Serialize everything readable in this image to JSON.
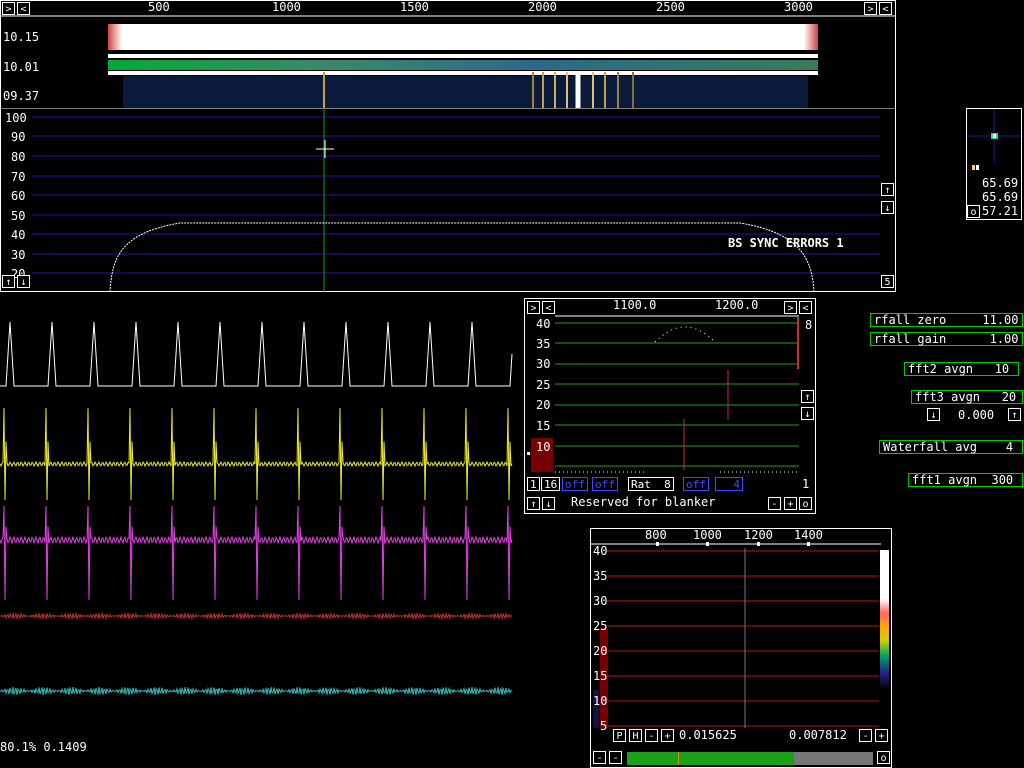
{
  "top": {
    "freq_ticks": [
      "500",
      "1000",
      "1500",
      "2000",
      "2500",
      "3000"
    ],
    "time_labels": [
      "10.15",
      "10.01",
      "09.37"
    ],
    "y_ticks": [
      "100",
      "90",
      "80",
      "70",
      "60",
      "50",
      "40",
      "30",
      "20"
    ],
    "overlay_text": "BS SYNC ERRORS 1",
    "corner_value": "5"
  },
  "side_panel": {
    "values": [
      "65.69",
      "65.69",
      "57.21"
    ],
    "o_label": "o"
  },
  "params": {
    "waterfall_zero": "rfall zero     11.00",
    "waterfall_gain": "rfall gain      1.00",
    "fft2_avgn": "fft2 avgn   10",
    "fft3_avgn": "fft3 avgn   20",
    "arrow_value": "0.000",
    "waterfall_avg": "Waterfall avg    4",
    "fft1_avgn": "fft1 avgn  300"
  },
  "mid_panel": {
    "freq_ticks": [
      "1100.0",
      "1200.0"
    ],
    "y_ticks": [
      "40",
      "35",
      "30",
      "25",
      "20",
      "15",
      "10"
    ],
    "right_value_top": "8",
    "right_value_bottom": "1",
    "ctl_1": "1",
    "ctl_16": "16",
    "ctl_off1": "off",
    "ctl_off2": "off",
    "ctl_rat": "Rat  8",
    "ctl_off3": "off",
    "ctl_4": "4",
    "reserved": "Reserved for blanker",
    "minus": "-",
    "plus": "+",
    "o": "o"
  },
  "bottom_panel": {
    "freq_ticks": [
      "800",
      "1000",
      "1200",
      "1400"
    ],
    "y_ticks": [
      "40",
      "35",
      "30",
      "25",
      "20",
      "15",
      "10",
      "5"
    ],
    "p_label": "P",
    "h_label": "H",
    "value_left": "0.015625",
    "value_right": "0.007812",
    "o": "o"
  },
  "status": {
    "text": "80.1% 0.1409"
  },
  "colors": {
    "grid_blue": "#1a1aa6",
    "grid_green": "#1ea01e",
    "grid_red": "#b01818",
    "trace_white": "#ffffff",
    "trace_yellow": "#e8e830",
    "trace_magenta": "#e040e0",
    "trace_red": "#c03030",
    "trace_cyan": "#30c0c0"
  }
}
